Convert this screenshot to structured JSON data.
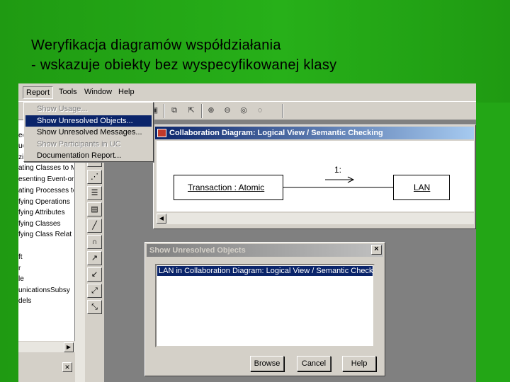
{
  "slide": {
    "title_line1": "Weryfikacja diagramów współdziałania",
    "title_line2": "- wskazuje obiekty bez wyspecyfikowanej klasy"
  },
  "menubar": {
    "items": [
      "Report",
      "Tools",
      "Window",
      "Help"
    ]
  },
  "report_menu": {
    "items": [
      {
        "label": "Show Usage...",
        "state": "disabled"
      },
      {
        "label": "Show Unresolved Objects...",
        "state": "highlighted"
      },
      {
        "label": "Show Unresolved Messages...",
        "state": "enabled"
      },
      {
        "label": "Show Participants in UC",
        "state": "disabled"
      },
      {
        "label": "Documentation Report...",
        "state": "enabled"
      }
    ]
  },
  "browser": {
    "items": [
      "ecifications",
      "uction",
      "zing a Scenario",
      "ating Classes to M",
      "esenting Event-or",
      "ating Processes to",
      "fying Operations",
      "fying Attributes",
      "fying Classes",
      "fying Class Relat",
      "ft",
      "r",
      "le",
      "unicationsSubsy",
      "dels"
    ]
  },
  "diagram_window": {
    "title": "Collaboration Diagram: Logical View / Semantic Checking",
    "object1": "Transaction : Atomic",
    "object2": "LAN",
    "link_label": "1:"
  },
  "dialog": {
    "title": "Show Unresolved Objects",
    "list_items": [
      "LAN in Collaboration Diagram: Logical View / Semantic Checking"
    ],
    "browse_label": "Browse",
    "cancel_label": "Cancel",
    "help_label": "Help"
  },
  "colors": {
    "slide_bg": "#27b019",
    "titlebar_active": "#0a246a",
    "window_face": "#d4d0c8"
  }
}
